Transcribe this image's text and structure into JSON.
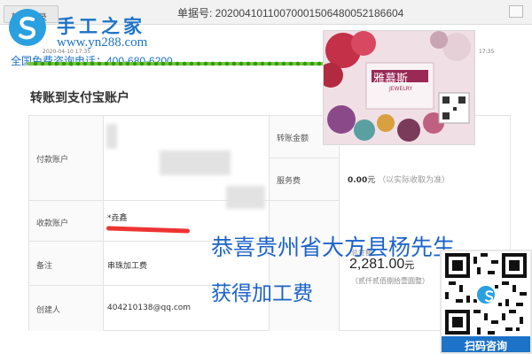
{
  "topbar": {
    "tab_label": "转账记录",
    "order_label": "单据号: 20200410110070001506480052186604"
  },
  "watermark": {
    "brand": "手工之家",
    "url": "www.yn288.com",
    "hotline": "全国免费咨询电话：400-680-6200"
  },
  "timeline": {
    "left_time": "2020-04-10 17:35",
    "right_time": "17:35",
    "progress": 1.0
  },
  "section": {
    "title": "转账到支付宝账户"
  },
  "fields": {
    "payer_label": "付款账户",
    "payee_label": "收款账户",
    "payee_value": "*垚鑫",
    "remark_label": "备注",
    "remark_value": "串珠加工费",
    "creator_label": "创建人",
    "creator_value": "404210138@qq.com",
    "amount_label": "转账金额",
    "fee_label": "服务费",
    "fee_value": "0.00",
    "fee_unit": "元",
    "fee_note": "（以实际收取为准）",
    "total_label": "总金额",
    "total_value": "2,281.00",
    "total_unit": "元",
    "total_caps": "（贰仟贰佰捌拾壹圆整）"
  },
  "overlay": {
    "line1": "恭喜贵州省大方县杨先生",
    "line2": "获得加工费"
  },
  "qr": {
    "caption": "扫码咨询"
  },
  "photo": {
    "brand_text": "雅慕斯",
    "brand_sub": "JEWELRY"
  },
  "colors": {
    "brand_blue": "#1d73c7",
    "logo_blue": "#2aa0e0",
    "progress_green": "#2aa000",
    "mark_red": "#e33333"
  }
}
